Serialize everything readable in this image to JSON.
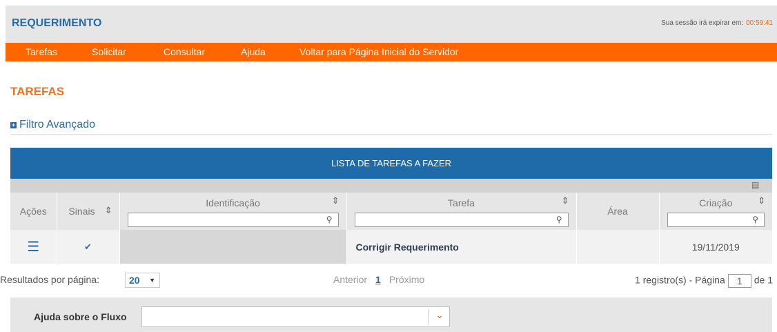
{
  "header": {
    "title": "REQUERIMENTO",
    "session_label": "Sua sessão irá expirar em:",
    "session_time": "00:59:41"
  },
  "menu": [
    {
      "label": "Tarefas"
    },
    {
      "label": "Solicitar"
    },
    {
      "label": "Consultar"
    },
    {
      "label": "Ajuda"
    },
    {
      "label": "Voltar para Página Inicial do Servidor"
    }
  ],
  "page_title": "TAREFAS",
  "filter_label": "Filtro Avançado",
  "table": {
    "title": "LISTA DE TAREFAS A FAZER",
    "columns": [
      {
        "label": "Ações"
      },
      {
        "label": "Sinais"
      },
      {
        "label": "Identificação"
      },
      {
        "label": "Tarefa"
      },
      {
        "label": "Área"
      },
      {
        "label": "Criação"
      }
    ],
    "rows": [
      {
        "identificacao": "",
        "tarefa": "Corrigir Requerimento",
        "area": "",
        "criacao": "19/11/2019"
      }
    ]
  },
  "pagination": {
    "per_page_label": "Resultados por página:",
    "per_page_value": "20",
    "prev": "Anterior",
    "current": "1",
    "next": "Próximo",
    "records_label": "1 registro(s) - Página",
    "page_input": "1",
    "of_label": "de 1"
  },
  "help": {
    "label": "Ajuda sobre o Fluxo",
    "value": ""
  },
  "colors": {
    "accent_orange": "#ff6600",
    "brand_blue": "#1f6aa8",
    "header_gray": "#e6e6e6"
  }
}
